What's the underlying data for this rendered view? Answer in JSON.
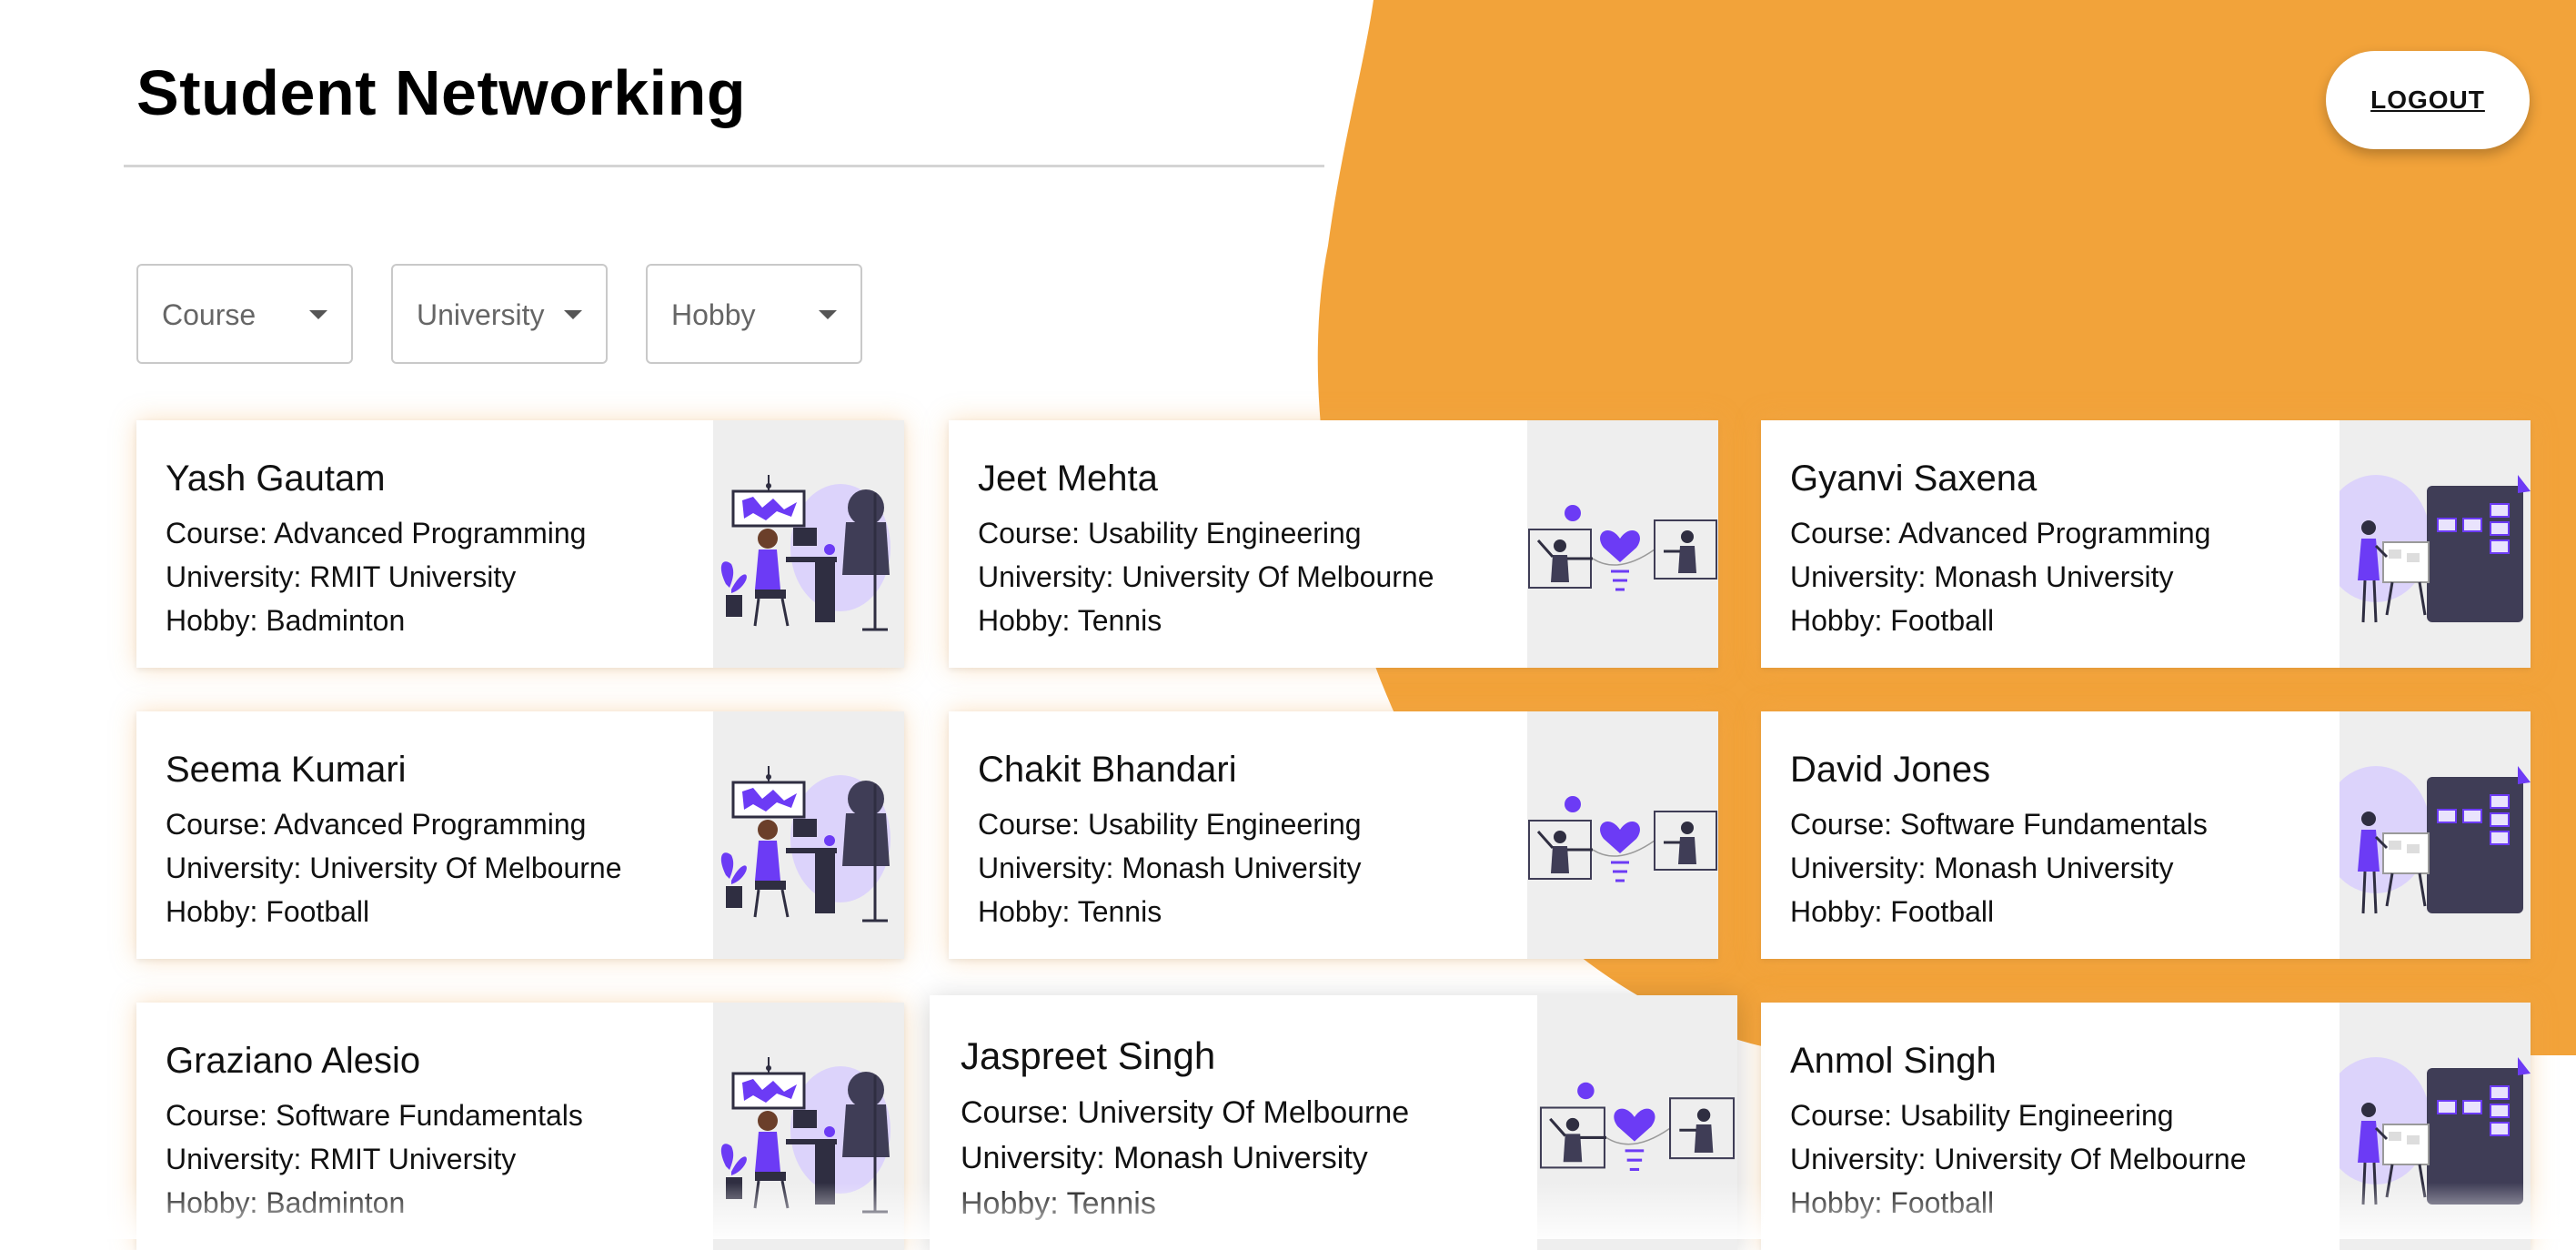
{
  "header": {
    "title": "Student Networking",
    "logout_label": "LOGOUT"
  },
  "filters": [
    {
      "label": "Course"
    },
    {
      "label": "University"
    },
    {
      "label": "Hobby"
    }
  ],
  "labels": {
    "course": "Course:",
    "university": "University:",
    "hobby": "Hobby:"
  },
  "colors": {
    "accent_orange": "#F2A33A",
    "illustration_purple": "#6C3BF5",
    "card_image_bg": "#EEEEEE"
  },
  "students": [
    {
      "name": "Yash Gautam",
      "course": "Advanced Programming",
      "university": "RMIT University",
      "hobby": "Badminton",
      "illustration": "desk-workspace-illustration"
    },
    {
      "name": "Jeet Mehta",
      "course": "Usability Engineering",
      "university": "University Of Melbourne",
      "hobby": "Tennis",
      "illustration": "connection-heart-illustration"
    },
    {
      "name": "Gyanvi Saxena",
      "course": "Advanced Programming",
      "university": "Monash University",
      "hobby": "Football",
      "illustration": "presentation-board-illustration"
    },
    {
      "name": "Seema Kumari",
      "course": "Advanced Programming",
      "university": "University Of Melbourne",
      "hobby": "Football",
      "illustration": "desk-workspace-illustration"
    },
    {
      "name": "Chakit Bhandari",
      "course": "Usability Engineering",
      "university": "Monash University",
      "hobby": "Tennis",
      "illustration": "connection-heart-illustration"
    },
    {
      "name": "David Jones",
      "course": "Software Fundamentals",
      "university": "Monash University",
      "hobby": "Football",
      "illustration": "presentation-board-illustration"
    },
    {
      "name": "Graziano Alesio",
      "course": "Software Fundamentals",
      "university": "RMIT University",
      "hobby": "Badminton",
      "illustration": "desk-workspace-illustration"
    },
    {
      "name": "Jaspreet Singh",
      "course": "University Of Melbourne",
      "university": "Monash University",
      "hobby": "Tennis",
      "illustration": "connection-heart-illustration"
    },
    {
      "name": "Anmol Singh",
      "course": "Usability Engineering",
      "university": "University Of Melbourne",
      "hobby": "Football",
      "illustration": "presentation-board-illustration"
    }
  ]
}
